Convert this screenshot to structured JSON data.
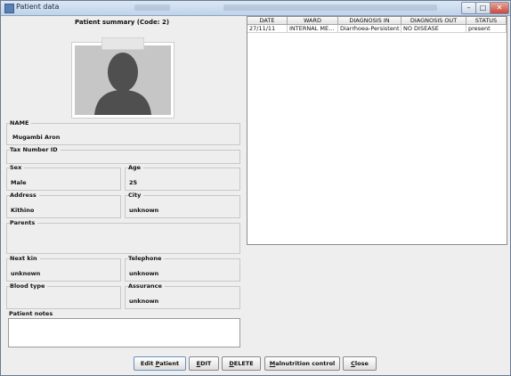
{
  "window": {
    "title": "Patient data"
  },
  "summary": {
    "title": "Patient summary (Code: 2)"
  },
  "fields": {
    "name": {
      "label": "NAME",
      "value": "Mugambi Aron"
    },
    "tax": {
      "label": "Tax Number ID",
      "value": ""
    },
    "sex": {
      "label": "Sex",
      "value": "Male"
    },
    "age": {
      "label": "Age",
      "value": "25"
    },
    "address": {
      "label": "Address",
      "value": "Kithino"
    },
    "city": {
      "label": "City",
      "value": "unknown"
    },
    "parents": {
      "label": "Parents",
      "value": ""
    },
    "next_kin": {
      "label": "Next kin",
      "value": "unknown"
    },
    "telephone": {
      "label": "Telephone",
      "value": "unknown"
    },
    "blood_type": {
      "label": "Blood type",
      "value": ""
    },
    "assurance": {
      "label": "Assurance",
      "value": "unknown"
    },
    "notes": {
      "label": "Patient notes",
      "value": ""
    }
  },
  "admissions_table": {
    "columns": [
      "DATE",
      "WARD",
      "DIAGNOSIS IN",
      "DIAGNOSIS OUT",
      "STATUS"
    ],
    "rows": [
      [
        "27/11/11",
        "INTERNAL ME...",
        "Diarrhoea-Persistent",
        "NO DISEASE",
        "present"
      ]
    ]
  },
  "buttons": {
    "edit_patient": {
      "pre": "Edit ",
      "ul": "P",
      "post": "atient"
    },
    "edit": {
      "pre": "",
      "ul": "E",
      "post": "DIT"
    },
    "delete": {
      "pre": "",
      "ul": "D",
      "post": "ELETE"
    },
    "malnutrition": {
      "pre": "",
      "ul": "M",
      "post": "alnutrition control"
    },
    "close": {
      "pre": "",
      "ul": "C",
      "post": "lose"
    }
  },
  "icons": {
    "window": "patient-window-icon",
    "photo": "person-silhouette-icon",
    "minimize": "minimize-icon",
    "maximize": "maximize-icon",
    "close": "close-icon"
  }
}
